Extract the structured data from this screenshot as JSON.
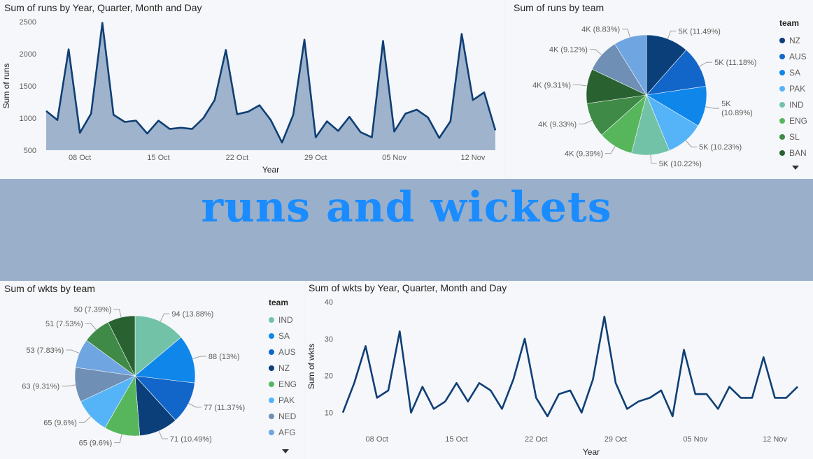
{
  "banner": {
    "title": "runs and wickets"
  },
  "runs_line": {
    "title": "Sum of runs by Year, Quarter, Month and Day"
  },
  "runs_pie": {
    "title": "Sum of runs by team",
    "legend_title": "team",
    "more_icon": "caret-down-icon"
  },
  "wkts_pie": {
    "title": "Sum of wkts by team",
    "legend_title": "team",
    "more_icon": "caret-down-icon"
  },
  "wkts_line": {
    "title": "Sum of wkts by Year, Quarter, Month and Day"
  },
  "colors": {
    "line": "#0f3f75",
    "area": "#8fa8c3",
    "NZ": "#0b3f7a",
    "AUS": "#1266c9",
    "SA": "#0e86ea",
    "PAK": "#55b4f7",
    "IND": "#72c2a8",
    "ENG": "#57b65c",
    "SL": "#3f8a46",
    "BAN": "#2a6130",
    "NED": "#6f8fb5",
    "AFG": "#6fa5e0"
  },
  "chart_data": [
    {
      "type": "area",
      "title": "Sum of runs by Year, Quarter, Month and Day",
      "xlabel": "Year",
      "ylabel": "Sum of runs",
      "x_ticks": [
        "08 Oct",
        "15 Oct",
        "22 Oct",
        "29 Oct",
        "05 Nov",
        "12 Nov"
      ],
      "y_ticks": [
        500,
        1000,
        1500,
        2000,
        2500
      ],
      "ylim": [
        500,
        2500
      ],
      "x": [
        "05 Oct",
        "06 Oct",
        "07 Oct",
        "08 Oct",
        "09 Oct",
        "10 Oct",
        "11 Oct",
        "12 Oct",
        "13 Oct",
        "14 Oct",
        "15 Oct",
        "16 Oct",
        "17 Oct",
        "18 Oct",
        "19 Oct",
        "20 Oct",
        "21 Oct",
        "22 Oct",
        "23 Oct",
        "24 Oct",
        "25 Oct",
        "26 Oct",
        "27 Oct",
        "28 Oct",
        "29 Oct",
        "30 Oct",
        "31 Oct",
        "01 Nov",
        "02 Nov",
        "03 Nov",
        "04 Nov",
        "05 Nov",
        "06 Nov",
        "07 Nov",
        "08 Nov",
        "09 Nov",
        "10 Nov",
        "11 Nov",
        "12 Nov",
        "15 Nov",
        "16 Nov"
      ],
      "values": [
        1110,
        970,
        2070,
        770,
        1070,
        2480,
        1050,
        940,
        960,
        760,
        960,
        830,
        850,
        830,
        1000,
        1280,
        2060,
        1060,
        1100,
        1200,
        970,
        620,
        1050,
        2220,
        700,
        950,
        800,
        1020,
        780,
        700,
        2200,
        790,
        1070,
        1130,
        1010,
        690,
        950,
        2310,
        1280,
        1400,
        810
      ],
      "grid": false
    },
    {
      "type": "pie",
      "title": "Sum of runs by team",
      "legend_title": "team",
      "legend": [
        "NZ",
        "AUS",
        "SA",
        "PAK",
        "IND",
        "ENG",
        "SL",
        "BAN"
      ],
      "slices": [
        {
          "team": "NZ",
          "percent": 11.49,
          "label": "5K (11.49%)"
        },
        {
          "team": "AUS",
          "percent": 11.18,
          "label": "5K (11.18%)"
        },
        {
          "team": "SA",
          "percent": 10.89,
          "label": "5K (10.89%)"
        },
        {
          "team": "PAK",
          "percent": 10.23,
          "label": "5K (10.23%)"
        },
        {
          "team": "IND",
          "percent": 10.22,
          "label": "5K (10.22%)"
        },
        {
          "team": "ENG",
          "percent": 9.39,
          "label": "4K (9.39%)"
        },
        {
          "team": "SL",
          "percent": 9.33,
          "label": "4K (9.33%)"
        },
        {
          "team": "BAN",
          "percent": 9.31,
          "label": "4K (9.31%)"
        },
        {
          "team": "NED",
          "percent": 9.12,
          "label": "4K (9.12%)"
        },
        {
          "team": "AFG",
          "percent": 8.83,
          "label": "4K (8.83%)"
        }
      ]
    },
    {
      "type": "pie",
      "title": "Sum of wkts by team",
      "legend_title": "team",
      "legend": [
        "IND",
        "SA",
        "AUS",
        "NZ",
        "ENG",
        "PAK",
        "NED",
        "AFG"
      ],
      "slices": [
        {
          "team": "IND",
          "value": 94,
          "label": "94 (13.88%)"
        },
        {
          "team": "SA",
          "value": 88,
          "label": "88 (13%)"
        },
        {
          "team": "AUS",
          "value": 77,
          "label": "77 (11.37%)"
        },
        {
          "team": "NZ",
          "value": 71,
          "label": "71 (10.49%)"
        },
        {
          "team": "ENG",
          "value": 65,
          "label": "65 (9.6%)"
        },
        {
          "team": "PAK",
          "value": 65,
          "label": "65 (9.6%)"
        },
        {
          "team": "NED",
          "value": 63,
          "label": "63 (9.31%)"
        },
        {
          "team": "AFG",
          "value": 53,
          "label": "53 (7.83%)"
        },
        {
          "team": "SL",
          "value": 51,
          "label": "51 (7.53%)"
        },
        {
          "team": "BAN",
          "value": 50,
          "label": "50 (7.39%)"
        }
      ]
    },
    {
      "type": "line",
      "title": "Sum of wkts by Year, Quarter, Month and Day",
      "xlabel": "Year",
      "ylabel": "Sum of wkts",
      "x_ticks": [
        "08 Oct",
        "15 Oct",
        "22 Oct",
        "29 Oct",
        "05 Nov",
        "12 Nov"
      ],
      "y_ticks": [
        10,
        20,
        30,
        40
      ],
      "ylim": [
        5,
        40
      ],
      "x": [
        "05 Oct",
        "06 Oct",
        "07 Oct",
        "08 Oct",
        "09 Oct",
        "10 Oct",
        "11 Oct",
        "12 Oct",
        "13 Oct",
        "14 Oct",
        "15 Oct",
        "16 Oct",
        "17 Oct",
        "18 Oct",
        "19 Oct",
        "20 Oct",
        "21 Oct",
        "22 Oct",
        "23 Oct",
        "24 Oct",
        "25 Oct",
        "26 Oct",
        "27 Oct",
        "28 Oct",
        "29 Oct",
        "30 Oct",
        "31 Oct",
        "01 Nov",
        "02 Nov",
        "03 Nov",
        "04 Nov",
        "05 Nov",
        "06 Nov",
        "07 Nov",
        "08 Nov",
        "09 Nov",
        "10 Nov",
        "11 Nov",
        "12 Nov",
        "15 Nov",
        "16 Nov"
      ],
      "values": [
        10,
        18,
        28,
        14,
        16,
        32,
        10,
        17,
        11,
        13,
        18,
        13,
        18,
        16,
        11,
        19,
        30,
        14,
        9,
        15,
        16,
        10,
        19,
        36,
        18,
        11,
        13,
        14,
        16,
        9,
        27,
        15,
        15,
        11,
        17,
        14,
        14,
        25,
        14,
        14,
        17
      ],
      "grid": false
    }
  ]
}
